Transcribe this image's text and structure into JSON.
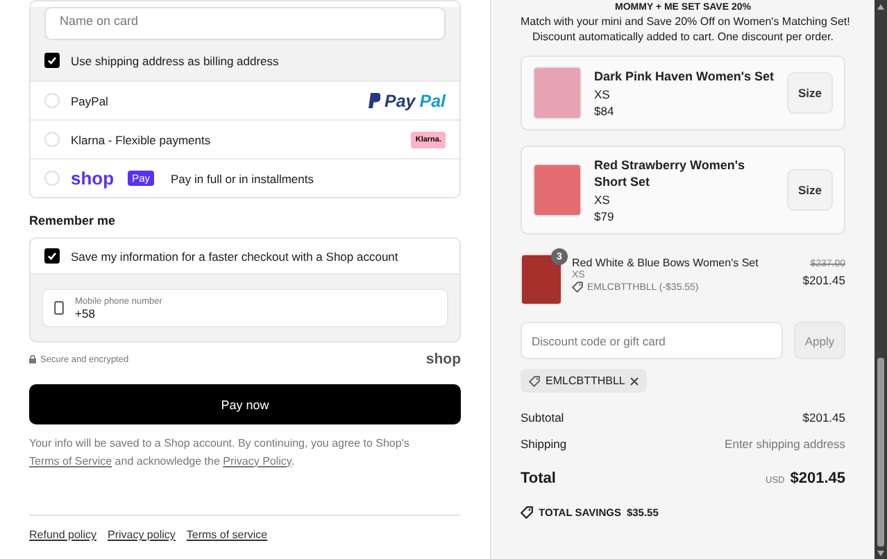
{
  "payment": {
    "card_name_field": {
      "placeholder": "Name on card"
    },
    "billing_same": {
      "label": "Use shipping address as billing address",
      "checked": true
    },
    "methods": [
      {
        "kind": "paypal",
        "label": "PayPal",
        "logo": "PayPal",
        "selected": false
      },
      {
        "kind": "klarna",
        "label": "Klarna - Flexible payments",
        "logo": "Klarna.",
        "selected": false
      },
      {
        "kind": "shoppay",
        "label": "Pay in full or in installments",
        "logo": "shop",
        "badge": "Pay",
        "selected": false
      }
    ]
  },
  "remember_me": {
    "heading": "Remember me",
    "save_info": {
      "label": "Save my information for a faster checkout with a Shop account",
      "checked": true
    },
    "phone_field": {
      "label": "Mobile phone number",
      "value": "+58"
    }
  },
  "secure_note": "Secure and encrypted",
  "shop_logo": "shop",
  "pay_button": "Pay now",
  "consent": {
    "before": "Your info will be saved to a Shop account. By continuing, you agree to Shop's ",
    "link_1": "Terms of Service",
    "middle": " and acknowledge the ",
    "link_2": "Privacy Policy",
    "after": "."
  },
  "footer_links": [
    "Refund policy",
    "Privacy policy",
    "Terms of service"
  ],
  "summary": {
    "promo_title": "MOMMY + ME SET SAVE 20%",
    "promo_lines": [
      "Match with your mini and Save 20% Off on Women's Matching Set!",
      "Discount automatically added to cart. One discount per order."
    ],
    "upsells": [
      {
        "name": "Dark Pink Haven Women's Set",
        "variant": "XS",
        "price": "$84",
        "button": "Size"
      },
      {
        "name": "Red Strawberry Women's Short Set",
        "variant": "XS",
        "price": "$79",
        "button": "Size"
      }
    ],
    "cart_items": [
      {
        "name": "Red White & Blue Bows Women's Set",
        "quantity": "3",
        "variant": "XS",
        "discount": "EMLCBTTHBLL (-$35.55)",
        "original_price": "$237.00",
        "price": "$201.45"
      }
    ],
    "discount_field": {
      "placeholder": "Discount code or gift card"
    },
    "apply_button": {
      "label": "Apply",
      "disabled": true
    },
    "applied_code": "EMLCBTTHBLL",
    "rows": [
      {
        "label": "Subtotal",
        "value": "$201.45",
        "muted": false
      },
      {
        "label": "Shipping",
        "value": "Enter shipping address",
        "muted": true
      }
    ],
    "total": {
      "label": "Total",
      "currency": "USD",
      "value": "$201.45"
    },
    "savings": {
      "label": "TOTAL SAVINGS",
      "value": "$35.55"
    }
  }
}
